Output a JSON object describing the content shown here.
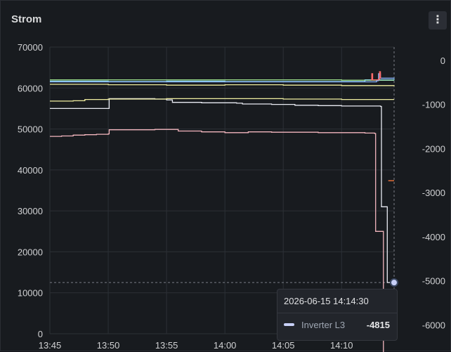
{
  "panel": {
    "title": "Strom"
  },
  "tooltip": {
    "time": "2026-06-15 14:14:30",
    "series_name": "Inverter L3",
    "value": "-4815"
  },
  "colors": {
    "background": "#181b1f",
    "grid": "#2c3036",
    "pink": "#f2b6be",
    "white": "#e8eaf2",
    "yellow": "#f0eea0",
    "green": "#9ee38f",
    "cyan": "#8fd8e0",
    "blue": "#8ab8ff",
    "lightblue": "#c8d0f7",
    "red": "#ff6b6b",
    "orange": "#ff7a3d"
  },
  "chart_data": {
    "type": "line",
    "title": "Strom",
    "x_unit": "time",
    "x_ticks": [
      "13:45",
      "13:50",
      "13:55",
      "14:00",
      "14:05",
      "14:10"
    ],
    "xlim": [
      "13:45",
      "14:14:30"
    ],
    "y_left_ticks": [
      "0",
      "10000",
      "20000",
      "30000",
      "40000",
      "50000",
      "60000",
      "70000"
    ],
    "ylim_left": [
      0,
      70000
    ],
    "y_right_ticks": [
      "0",
      "-1000",
      "-2000",
      "-3000",
      "-4000",
      "-5000",
      "-6000"
    ],
    "ylim_right": [
      -6200,
      300
    ],
    "grid": true,
    "crosshair": {
      "x": "14:14:30",
      "y_left": 12500
    },
    "series": [
      {
        "color": "#f2b6be",
        "axis": "left",
        "points": [
          [
            "13:45",
            48200
          ],
          [
            "13:46",
            48300
          ],
          [
            "13:47",
            48500
          ],
          [
            "13:48",
            48600
          ],
          [
            "13:49",
            48700
          ],
          [
            "13:50",
            48800
          ],
          [
            "13:50:05",
            49800
          ],
          [
            "13:52",
            49800
          ],
          [
            "13:54",
            49900
          ],
          [
            "13:55",
            49900
          ],
          [
            "13:56",
            49500
          ],
          [
            "13:58",
            49300
          ],
          [
            "14:00",
            49100
          ],
          [
            "14:02",
            49300
          ],
          [
            "14:04",
            49200
          ],
          [
            "14:06",
            49200
          ],
          [
            "14:08",
            49100
          ],
          [
            "14:10",
            49100
          ],
          [
            "14:12",
            49000
          ],
          [
            "14:12:50",
            48900
          ],
          [
            "14:12:55",
            25000
          ],
          [
            "14:13:30",
            25000
          ],
          [
            "14:13:35",
            -5000
          ],
          [
            "14:14:30",
            -5000
          ]
        ]
      },
      {
        "color": "#e8eaf2",
        "axis": "left",
        "points": [
          [
            "13:45",
            55000
          ],
          [
            "13:48",
            55000
          ],
          [
            "13:50",
            55000
          ],
          [
            "13:50:05",
            57400
          ],
          [
            "13:54",
            57300
          ],
          [
            "13:55",
            57100
          ],
          [
            "13:55:30",
            56500
          ],
          [
            "13:58",
            56400
          ],
          [
            "14:01",
            56300
          ],
          [
            "14:01:30",
            56100
          ],
          [
            "14:04",
            56000
          ],
          [
            "14:06",
            55800
          ],
          [
            "14:08",
            55700
          ],
          [
            "14:10",
            55600
          ],
          [
            "14:12",
            55600
          ],
          [
            "14:13:20",
            55500
          ],
          [
            "14:13:25",
            31000
          ],
          [
            "14:13:50",
            31000
          ],
          [
            "14:13:55",
            12500
          ],
          [
            "14:14:30",
            12500
          ]
        ]
      },
      {
        "color": "#f0eea0",
        "axis": "left",
        "points": [
          [
            "13:45",
            56800
          ],
          [
            "13:47",
            56900
          ],
          [
            "13:48",
            57200
          ],
          [
            "13:50",
            57300
          ],
          [
            "13:55",
            57400
          ],
          [
            "14:00",
            57400
          ],
          [
            "14:05",
            57300
          ],
          [
            "14:10",
            57200
          ],
          [
            "14:12",
            57200
          ],
          [
            "14:14:30",
            57200
          ]
        ]
      },
      {
        "color": "#f0eea0",
        "axis": "left",
        "points": [
          [
            "13:45",
            60900
          ],
          [
            "13:50",
            60800
          ],
          [
            "13:55",
            60700
          ],
          [
            "14:00",
            60800
          ],
          [
            "14:05",
            60700
          ],
          [
            "14:10",
            60600
          ],
          [
            "14:14:30",
            60500
          ]
        ]
      },
      {
        "color": "#9ee38f",
        "axis": "left",
        "points": [
          [
            "13:45",
            62000
          ],
          [
            "13:50",
            62000
          ],
          [
            "13:55",
            62000
          ],
          [
            "14:00",
            62000
          ],
          [
            "14:05",
            62000
          ],
          [
            "14:10",
            61900
          ],
          [
            "14:14:30",
            61900
          ]
        ]
      },
      {
        "color": "#8fd8e0",
        "axis": "left",
        "points": [
          [
            "13:45",
            61700
          ],
          [
            "13:50",
            61600
          ],
          [
            "13:55",
            61700
          ],
          [
            "14:00",
            61600
          ],
          [
            "14:05",
            61600
          ],
          [
            "14:10",
            61600
          ],
          [
            "14:12",
            62000
          ],
          [
            "14:14:30",
            62200
          ]
        ]
      },
      {
        "color": "#8ab8ff",
        "axis": "left",
        "points": [
          [
            "13:45",
            61500
          ],
          [
            "13:50",
            61500
          ],
          [
            "13:55",
            61500
          ],
          [
            "14:00",
            61500
          ],
          [
            "14:05",
            61500
          ],
          [
            "14:10",
            61500
          ],
          [
            "14:13",
            61800
          ],
          [
            "14:13:10",
            63500
          ],
          [
            "14:13:20",
            62400
          ],
          [
            "14:14:30",
            62300
          ]
        ]
      },
      {
        "color": "#ff6b6b",
        "axis": "left",
        "points": [
          [
            "14:12:30",
            62000
          ],
          [
            "14:12:35",
            63500
          ],
          [
            "14:12:40",
            62000
          ],
          [
            "14:13:10",
            62200
          ],
          [
            "14:13:15",
            64000
          ],
          [
            "14:13:20",
            62300
          ]
        ]
      },
      {
        "color": "#ff7a3d",
        "axis": "right",
        "points": [
          [
            "14:14",
            -2730
          ],
          [
            "14:14:30",
            -2730
          ]
        ]
      }
    ]
  }
}
